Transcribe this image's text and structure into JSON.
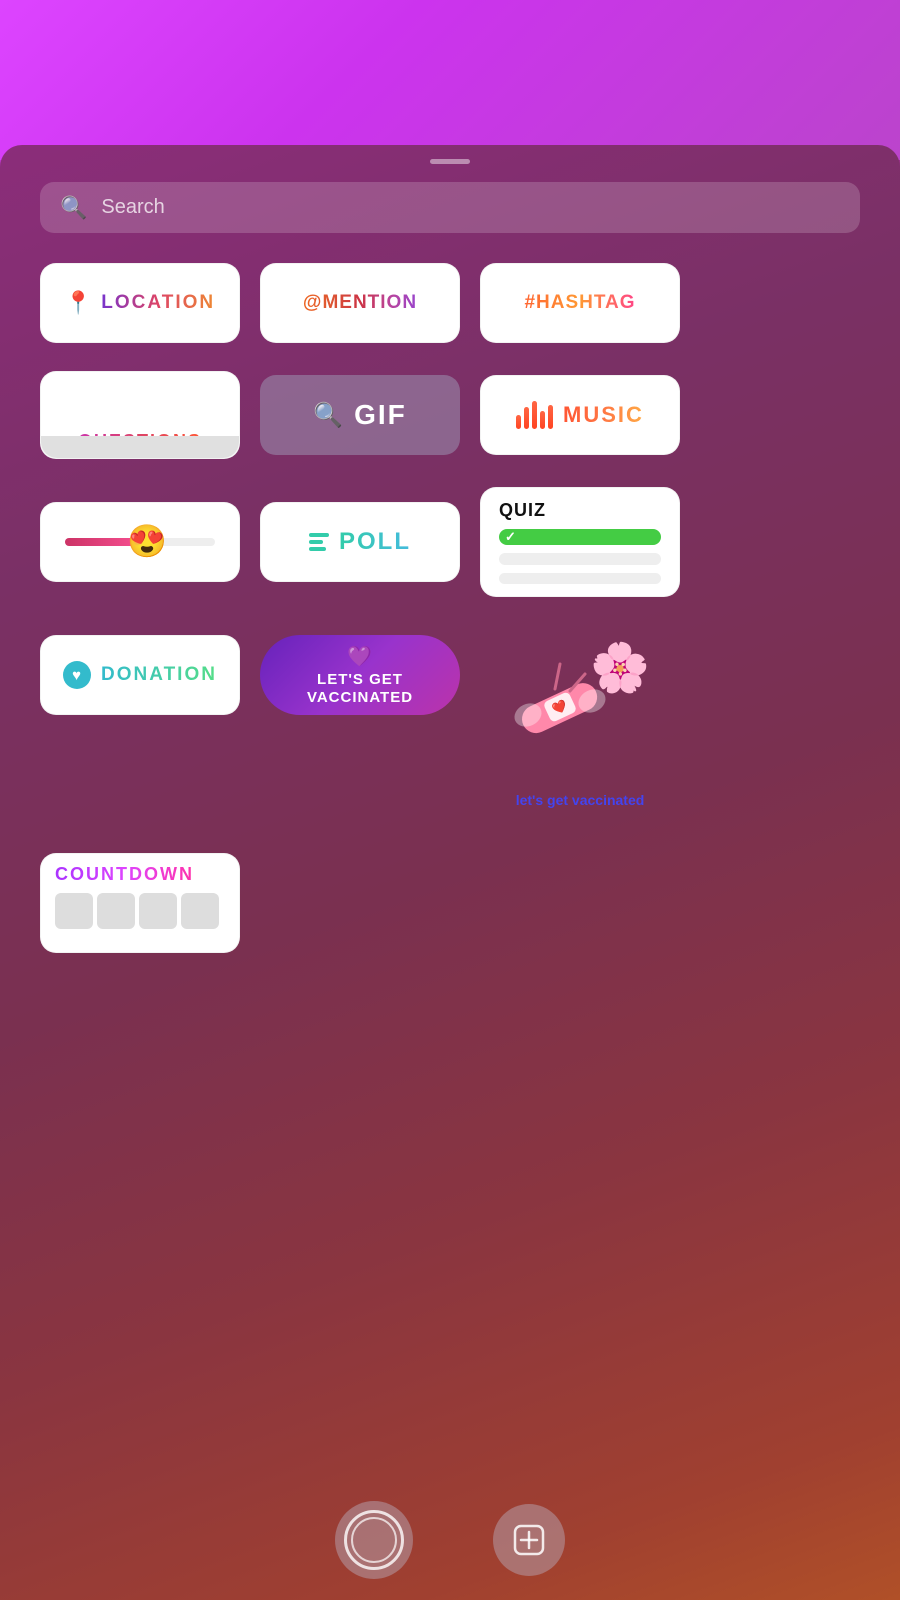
{
  "background": {
    "top_gradient": "linear-gradient(135deg, #dd44ff, #cc33ee, #bb44cc)",
    "main_gradient": "linear-gradient(160deg, #8b2d7a, #7a3065, #7a3050, #8a3540, #a04030, #b05028)"
  },
  "search": {
    "placeholder": "Search"
  },
  "stickers": {
    "row1": [
      {
        "id": "location",
        "label": "LOCATION",
        "icon": "📍"
      },
      {
        "id": "mention",
        "label": "@MENTION"
      },
      {
        "id": "hashtag",
        "label": "#HASHTAG"
      }
    ],
    "row2": [
      {
        "id": "questions",
        "label": "QUESTIONS"
      },
      {
        "id": "gif",
        "label": "GIF"
      },
      {
        "id": "music",
        "label": "MUSIC"
      }
    ],
    "row3": [
      {
        "id": "slider",
        "label": ""
      },
      {
        "id": "poll",
        "label": "POLL"
      },
      {
        "id": "quiz",
        "label": "QUIZ"
      }
    ],
    "row4": [
      {
        "id": "donation",
        "label": "DONATION"
      },
      {
        "id": "vaccinated",
        "label": "LET'S GET\nVACCINATED"
      },
      {
        "id": "vac-art",
        "label": "let's get\nvaccinated"
      }
    ],
    "row5": [
      {
        "id": "countdown",
        "label": "COUNTDOWN"
      }
    ]
  },
  "bottom_bar": {
    "camera_label": "camera",
    "sticker_add_label": "add-sticker"
  }
}
